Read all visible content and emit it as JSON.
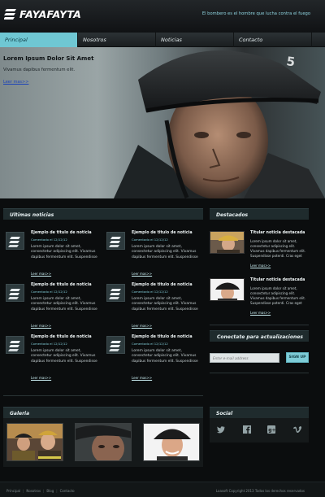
{
  "header": {
    "logo_text": "FAYAFAYTA",
    "tagline": "El bombero es el hombre que lucha contra el fuego"
  },
  "nav": {
    "items": [
      "Principal",
      "Nosotros",
      "Noticias",
      "Contacto"
    ]
  },
  "hero": {
    "title": "Lorem Ipsum Dolor Sit Amet",
    "text": "Vivamus dapibus fermentum elit.",
    "link": "Leer mas>>"
  },
  "news": {
    "heading": "Ultimas noticias",
    "items": [
      {
        "title": "Ejemplo de titulo de noticia",
        "date": "Comentado el 12/12/12",
        "body": "Lorem ipsum dolor sit amet, consectetur adipiscing elit. Vivamus dapibus fermentum elit. Suspendisse",
        "more": "Leer mas>>"
      },
      {
        "title": "Ejemplo de titulo de noticia",
        "date": "Comentado el 12/12/12",
        "body": "Lorem ipsum dolor sit amet, consectetur adipiscing elit. Vivamus dapibus fermentum elit. Suspendisse",
        "more": "Leer mas>>"
      },
      {
        "title": "Ejemplo de titulo de noticia",
        "date": "Comentado el 12/12/12",
        "body": "Lorem ipsum dolor sit amet, consectetur adipiscing elit. Vivamus dapibus fermentum elit. Suspendisse",
        "more": "Leer mas>>"
      },
      {
        "title": "Ejemplo de titulo de noticia",
        "date": "Comentado el 12/12/12",
        "body": "Lorem ipsum dolor sit amet, consectetur adipiscing elit. Vivamus dapibus fermentum elit. Suspendisse",
        "more": "Leer mas>>"
      },
      {
        "title": "Ejemplo de titulo de noticia",
        "date": "Comentado el 12/12/12",
        "body": "Lorem ipsum dolor sit amet, consectetur adipiscing elit. Vivamus dapibus fermentum elit. Suspendisse",
        "more": "Leer mas>>"
      },
      {
        "title": "Ejemplo de titulo de noticia",
        "date": "Comentado el 12/12/12",
        "body": "Lorem ipsum dolor sit amet, consectetur adipiscing elit. Vivamus dapibus fermentum elit. Suspendisse",
        "more": "Leer mas>>"
      }
    ]
  },
  "featured": {
    "heading": "Destacados",
    "items": [
      {
        "title": "Titular noticia destacada",
        "body": "Lorem ipsum dolor sit amet, consectetur adipiscing elit. Vivamus dapibus fermentum elit. Suspendisse potenti. Cras eget",
        "more": "Leer mas>>"
      },
      {
        "title": "Titular noticia destacada",
        "body": "Lorem ipsum dolor sit amet, consectetur adipiscing elit. Vivamus dapibus fermentum elit. Suspendisse potenti. Cras eget",
        "more": "Leer mas>>"
      }
    ]
  },
  "subscribe": {
    "heading": "Conectate para actualizaciones",
    "placeholder": "Enter e-mail address",
    "button": "SIGN UP"
  },
  "gallery": {
    "heading": "Galeria"
  },
  "social": {
    "heading": "Social",
    "icons": [
      "twitter-icon",
      "facebook-icon",
      "google-plus-icon",
      "vimeo-icon"
    ]
  },
  "footer": {
    "links": [
      "Principal",
      "Nosotros",
      "Blog",
      "Contacto"
    ],
    "copyright": "Loasoft Copyright 2013 Todos los derechos reservados"
  },
  "colors": {
    "accent": "#6fc7d3",
    "background": "#0b0d0e",
    "panel": "#1f2b2d"
  }
}
